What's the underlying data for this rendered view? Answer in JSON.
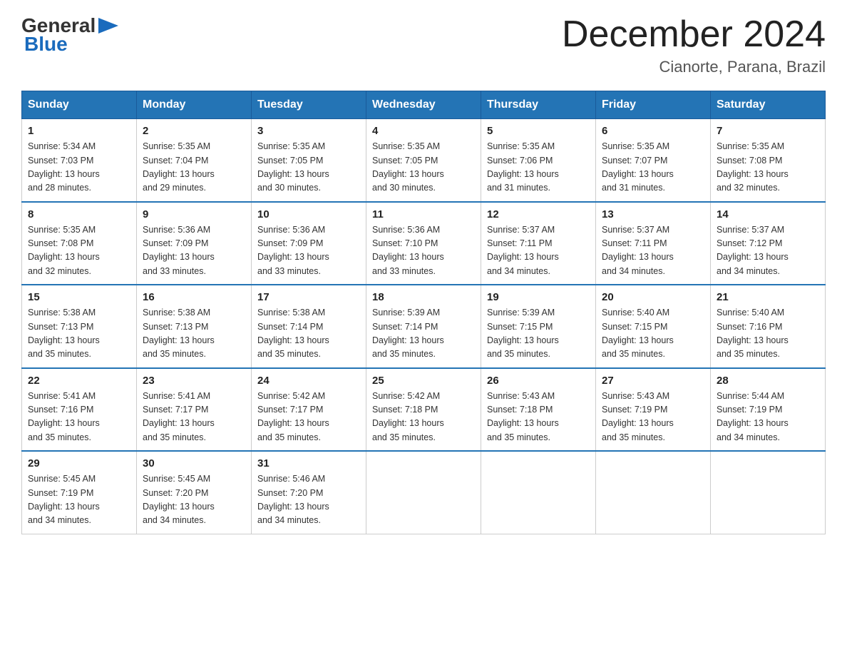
{
  "logo": {
    "general": "General",
    "blue": "Blue"
  },
  "title": "December 2024",
  "location": "Cianorte, Parana, Brazil",
  "days_of_week": [
    "Sunday",
    "Monday",
    "Tuesday",
    "Wednesday",
    "Thursday",
    "Friday",
    "Saturday"
  ],
  "weeks": [
    [
      {
        "day": "1",
        "sunrise": "5:34 AM",
        "sunset": "7:03 PM",
        "daylight": "13 hours and 28 minutes."
      },
      {
        "day": "2",
        "sunrise": "5:35 AM",
        "sunset": "7:04 PM",
        "daylight": "13 hours and 29 minutes."
      },
      {
        "day": "3",
        "sunrise": "5:35 AM",
        "sunset": "7:05 PM",
        "daylight": "13 hours and 30 minutes."
      },
      {
        "day": "4",
        "sunrise": "5:35 AM",
        "sunset": "7:05 PM",
        "daylight": "13 hours and 30 minutes."
      },
      {
        "day": "5",
        "sunrise": "5:35 AM",
        "sunset": "7:06 PM",
        "daylight": "13 hours and 31 minutes."
      },
      {
        "day": "6",
        "sunrise": "5:35 AM",
        "sunset": "7:07 PM",
        "daylight": "13 hours and 31 minutes."
      },
      {
        "day": "7",
        "sunrise": "5:35 AM",
        "sunset": "7:08 PM",
        "daylight": "13 hours and 32 minutes."
      }
    ],
    [
      {
        "day": "8",
        "sunrise": "5:35 AM",
        "sunset": "7:08 PM",
        "daylight": "13 hours and 32 minutes."
      },
      {
        "day": "9",
        "sunrise": "5:36 AM",
        "sunset": "7:09 PM",
        "daylight": "13 hours and 33 minutes."
      },
      {
        "day": "10",
        "sunrise": "5:36 AM",
        "sunset": "7:09 PM",
        "daylight": "13 hours and 33 minutes."
      },
      {
        "day": "11",
        "sunrise": "5:36 AM",
        "sunset": "7:10 PM",
        "daylight": "13 hours and 33 minutes."
      },
      {
        "day": "12",
        "sunrise": "5:37 AM",
        "sunset": "7:11 PM",
        "daylight": "13 hours and 34 minutes."
      },
      {
        "day": "13",
        "sunrise": "5:37 AM",
        "sunset": "7:11 PM",
        "daylight": "13 hours and 34 minutes."
      },
      {
        "day": "14",
        "sunrise": "5:37 AM",
        "sunset": "7:12 PM",
        "daylight": "13 hours and 34 minutes."
      }
    ],
    [
      {
        "day": "15",
        "sunrise": "5:38 AM",
        "sunset": "7:13 PM",
        "daylight": "13 hours and 35 minutes."
      },
      {
        "day": "16",
        "sunrise": "5:38 AM",
        "sunset": "7:13 PM",
        "daylight": "13 hours and 35 minutes."
      },
      {
        "day": "17",
        "sunrise": "5:38 AM",
        "sunset": "7:14 PM",
        "daylight": "13 hours and 35 minutes."
      },
      {
        "day": "18",
        "sunrise": "5:39 AM",
        "sunset": "7:14 PM",
        "daylight": "13 hours and 35 minutes."
      },
      {
        "day": "19",
        "sunrise": "5:39 AM",
        "sunset": "7:15 PM",
        "daylight": "13 hours and 35 minutes."
      },
      {
        "day": "20",
        "sunrise": "5:40 AM",
        "sunset": "7:15 PM",
        "daylight": "13 hours and 35 minutes."
      },
      {
        "day": "21",
        "sunrise": "5:40 AM",
        "sunset": "7:16 PM",
        "daylight": "13 hours and 35 minutes."
      }
    ],
    [
      {
        "day": "22",
        "sunrise": "5:41 AM",
        "sunset": "7:16 PM",
        "daylight": "13 hours and 35 minutes."
      },
      {
        "day": "23",
        "sunrise": "5:41 AM",
        "sunset": "7:17 PM",
        "daylight": "13 hours and 35 minutes."
      },
      {
        "day": "24",
        "sunrise": "5:42 AM",
        "sunset": "7:17 PM",
        "daylight": "13 hours and 35 minutes."
      },
      {
        "day": "25",
        "sunrise": "5:42 AM",
        "sunset": "7:18 PM",
        "daylight": "13 hours and 35 minutes."
      },
      {
        "day": "26",
        "sunrise": "5:43 AM",
        "sunset": "7:18 PM",
        "daylight": "13 hours and 35 minutes."
      },
      {
        "day": "27",
        "sunrise": "5:43 AM",
        "sunset": "7:19 PM",
        "daylight": "13 hours and 35 minutes."
      },
      {
        "day": "28",
        "sunrise": "5:44 AM",
        "sunset": "7:19 PM",
        "daylight": "13 hours and 34 minutes."
      }
    ],
    [
      {
        "day": "29",
        "sunrise": "5:45 AM",
        "sunset": "7:19 PM",
        "daylight": "13 hours and 34 minutes."
      },
      {
        "day": "30",
        "sunrise": "5:45 AM",
        "sunset": "7:20 PM",
        "daylight": "13 hours and 34 minutes."
      },
      {
        "day": "31",
        "sunrise": "5:46 AM",
        "sunset": "7:20 PM",
        "daylight": "13 hours and 34 minutes."
      },
      null,
      null,
      null,
      null
    ]
  ],
  "labels": {
    "sunrise": "Sunrise:",
    "sunset": "Sunset:",
    "daylight": "Daylight:"
  },
  "colors": {
    "header_bg": "#2474b5",
    "border": "#aaa"
  }
}
